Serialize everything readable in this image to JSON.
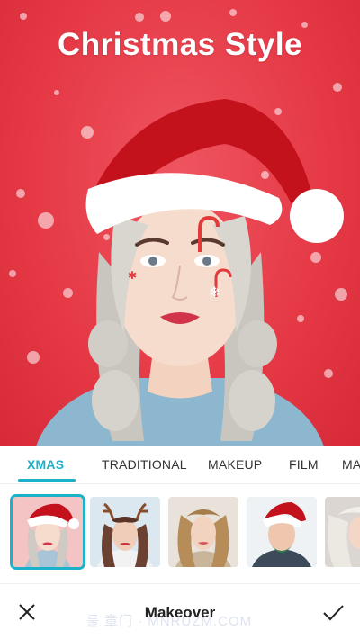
{
  "hero": {
    "title": "Christmas Style"
  },
  "tabs": [
    {
      "label": "XMAS",
      "active": true
    },
    {
      "label": "TRADITIONAL",
      "active": false
    },
    {
      "label": "MAKEUP",
      "active": false
    },
    {
      "label": "FILM",
      "active": false
    },
    {
      "label": "MA",
      "active": false
    }
  ],
  "thumbnails": [
    {
      "name": "santa-hat-style",
      "selected": true
    },
    {
      "name": "reindeer-antlers-style",
      "selected": false
    },
    {
      "name": "natural-makeup-style",
      "selected": false
    },
    {
      "name": "santa-beard-style",
      "selected": false
    },
    {
      "name": "platinum-hair-style",
      "selected": false
    }
  ],
  "bottom_bar": {
    "title": "Makeover",
    "close_icon": "close-icon",
    "confirm_icon": "checkmark-icon"
  },
  "watermark": "룰 章门 · MNRUZM.COM",
  "colors": {
    "accent": "#1bb2c9",
    "hero_bg": "#e63a47"
  }
}
